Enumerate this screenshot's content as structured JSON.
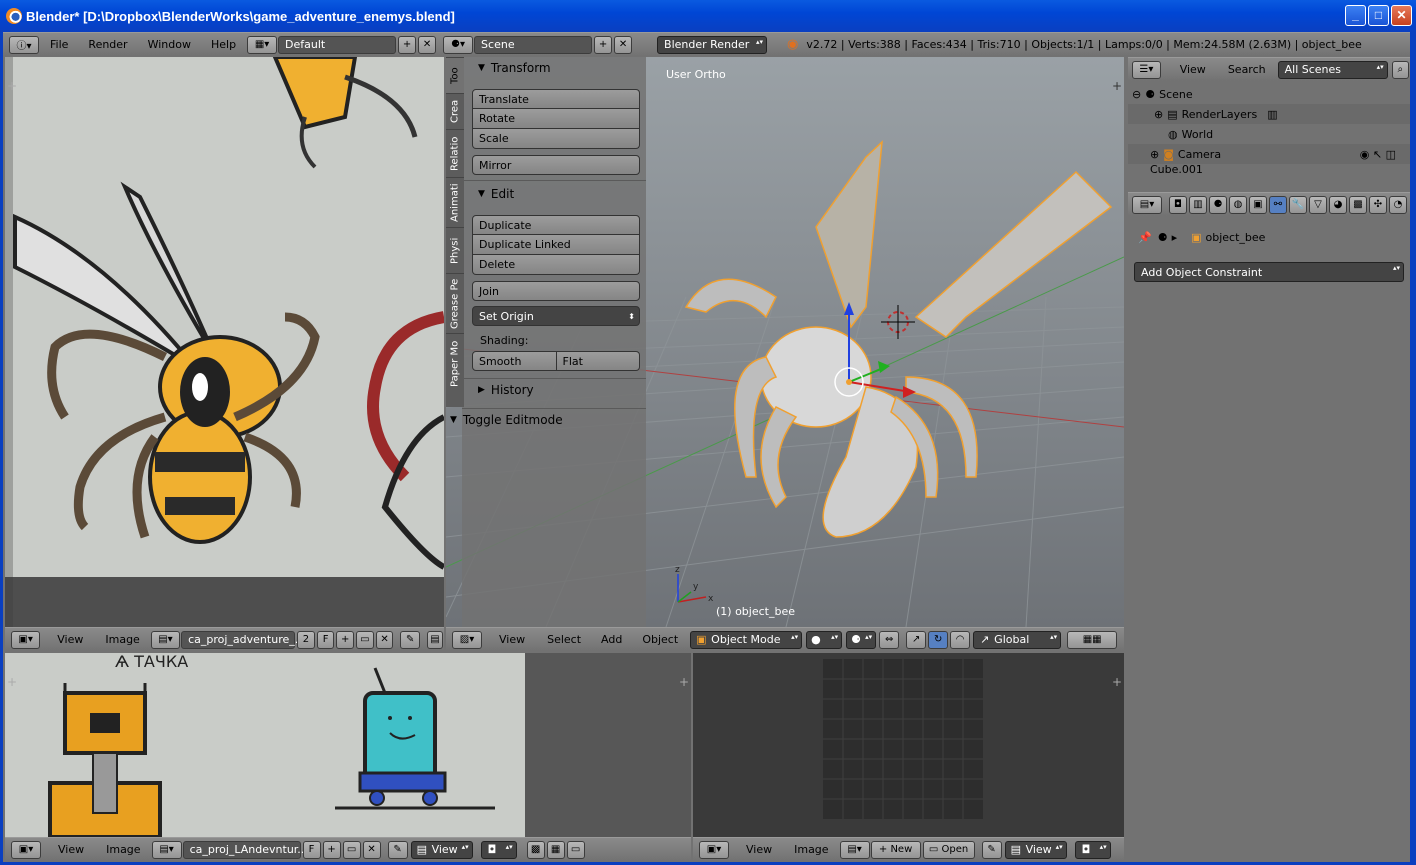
{
  "window": {
    "title": "Blender* [D:\\Dropbox\\BlenderWorks\\game_adventure_enemys.blend]"
  },
  "topbar": {
    "menus": [
      "File",
      "Render",
      "Window",
      "Help"
    ],
    "layout": "Default",
    "scene": "Scene",
    "engine": "Blender Render",
    "stats": "v2.72 | Verts:388 | Faces:434 | Tris:710 | Objects:1/1 | Lamps:0/0 | Mem:24.58M (2.63M) | object_bee"
  },
  "image_editor_top": {
    "menus": [
      "View",
      "Image"
    ],
    "image_name": "ca_proj_adventure_...",
    "users": "2",
    "fake": "F"
  },
  "toolshelf": {
    "tabs": [
      "Too",
      "Crea",
      "Relatio",
      "Animati",
      "Physi",
      "Grease Pe",
      "Paper Mo"
    ],
    "transform": {
      "title": "Transform",
      "buttons": [
        "Translate",
        "Rotate",
        "Scale"
      ],
      "mirror": "Mirror"
    },
    "edit": {
      "title": "Edit",
      "buttons": [
        "Duplicate",
        "Duplicate Linked",
        "Delete"
      ],
      "join": "Join",
      "set_origin": "Set Origin",
      "shading_label": "Shading:",
      "smooth": "Smooth",
      "flat": "Flat"
    },
    "history": {
      "title": "History"
    },
    "toggle_editmode": "Toggle Editmode"
  },
  "viewport": {
    "view_label": "User Ortho",
    "object_label": "(1) object_bee",
    "menus": [
      "View",
      "Select",
      "Add",
      "Object"
    ],
    "mode": "Object Mode",
    "orientation": "Global"
  },
  "outliner": {
    "menus": [
      "View",
      "Search"
    ],
    "filter": "All Scenes",
    "rows": [
      "Scene",
      "RenderLayers",
      "World",
      "Camera",
      "Cube.001"
    ]
  },
  "properties": {
    "object_name": "object_bee",
    "constraint_button": "Add Object Constraint"
  },
  "image_editor_bottom_left": {
    "menus": [
      "View",
      "Image"
    ],
    "image_name": "ca_proj_LAndevntur...",
    "fake": "F",
    "view": "View"
  },
  "image_editor_bottom_right": {
    "menus": [
      "View",
      "Image"
    ],
    "new": "New",
    "open": "Open",
    "view": "View"
  },
  "colors": {
    "accent": "#0a246a",
    "selection": "#f0a030",
    "panel": "#727272"
  }
}
